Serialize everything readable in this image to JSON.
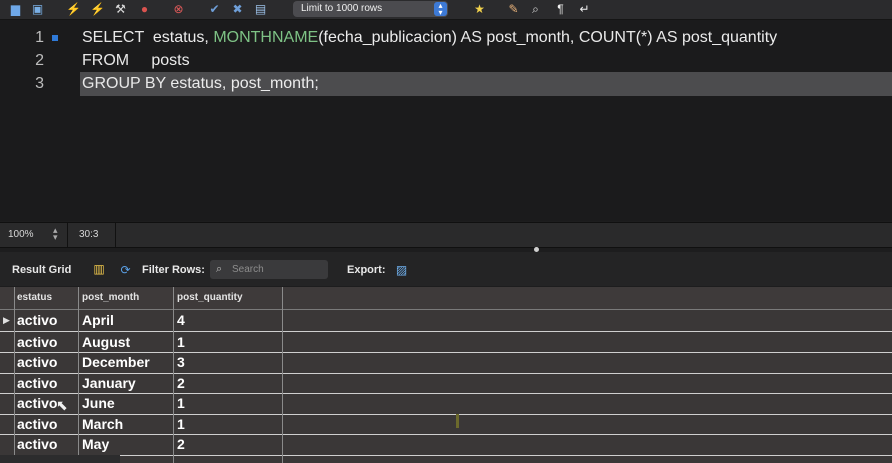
{
  "toolbar": {
    "icons": [
      "folder-icon",
      "save-icon",
      "execute-icon",
      "execute-current-icon",
      "explain-icon",
      "stop-icon",
      "toggle-continue-icon",
      "commit-icon",
      "rollback-icon",
      "autocommit-icon",
      "favorite-icon",
      "beautify-icon",
      "find-icon",
      "invisible-chars-icon",
      "wrap-icon"
    ],
    "limit_label": "Limit to 1000 rows"
  },
  "editor": {
    "lines": [
      {
        "num": "1",
        "kw1": "SELECT",
        "t1": "  estatus, ",
        "fn": "MONTHNAME",
        "t2": "(fecha_publicacion) ",
        "kw2": "AS",
        "t3": " post_month, ",
        "kw3": "COUNT",
        "t4": "(*) ",
        "kw4": "AS",
        "t5": " post_quantity"
      },
      {
        "num": "2",
        "kw1": "FROM",
        "t1": "     posts"
      },
      {
        "num": "3",
        "kw1": "GROUP BY",
        "t1": " estatus, post_month;"
      }
    ]
  },
  "status": {
    "zoom": "100%",
    "position": "30:3"
  },
  "results": {
    "tab_label": "Result Grid",
    "filter_label": "Filter Rows:",
    "search_placeholder": "Search",
    "export_label": "Export:",
    "columns": [
      "estatus",
      "post_month",
      "post_quantity"
    ],
    "rows": [
      [
        "activo",
        "April",
        "4"
      ],
      [
        "activo",
        "August",
        "1"
      ],
      [
        "activo",
        "December",
        "3"
      ],
      [
        "activo",
        "January",
        "2"
      ],
      [
        "activo",
        "June",
        "1"
      ],
      [
        "activo",
        "March",
        "1"
      ],
      [
        "activo",
        "May",
        "2"
      ]
    ]
  }
}
